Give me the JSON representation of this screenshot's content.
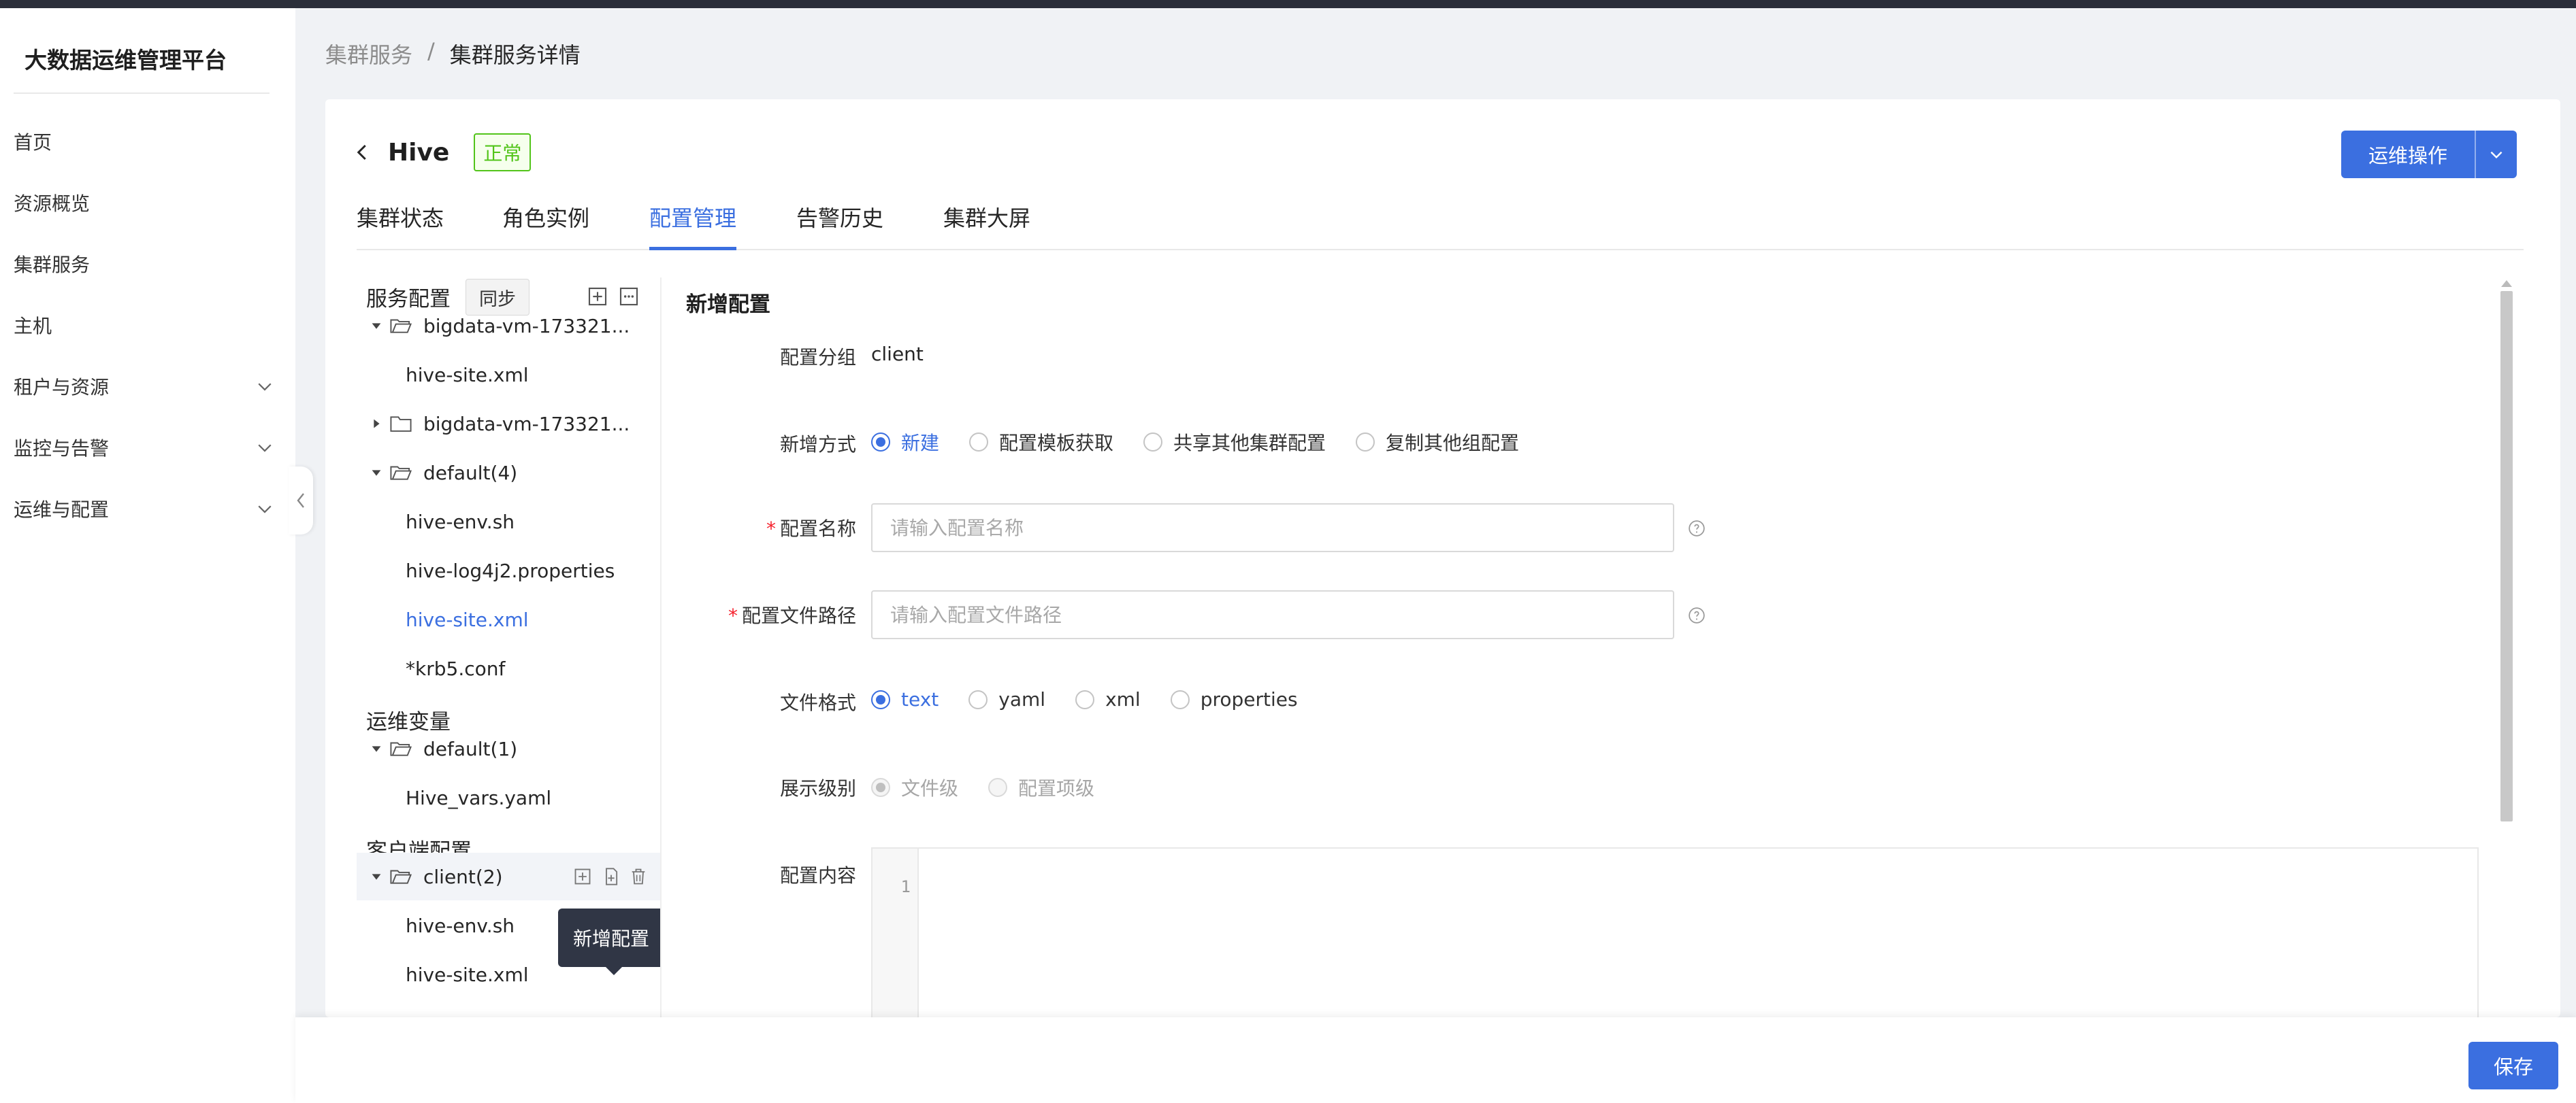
{
  "app": {
    "title": "大数据运维管理平台"
  },
  "sidebar": {
    "items": [
      {
        "label": "首页",
        "expandable": false
      },
      {
        "label": "资源概览",
        "expandable": false
      },
      {
        "label": "集群服务",
        "expandable": false
      },
      {
        "label": "主机",
        "expandable": false
      },
      {
        "label": "租户与资源",
        "expandable": true
      },
      {
        "label": "监控与告警",
        "expandable": true
      },
      {
        "label": "运维与配置",
        "expandable": true
      }
    ]
  },
  "breadcrumb": {
    "parent": "集群服务",
    "separator": "/",
    "current": "集群服务详情"
  },
  "header": {
    "service_name": "Hive",
    "status": "正常",
    "ops_button": "运维操作"
  },
  "tabs": [
    "集群状态",
    "角色实例",
    "配置管理",
    "告警历史",
    "集群大屏"
  ],
  "active_tab": 2,
  "tree": {
    "service_config_title": "服务配置",
    "sync_label": "同步",
    "service_nodes": [
      {
        "label": "bigdata-vm-173321...",
        "type": "folder",
        "expanded": true
      },
      {
        "label": "hive-site.xml",
        "type": "file"
      },
      {
        "label": "bigdata-vm-173321...",
        "type": "folder",
        "expanded": false
      },
      {
        "label": "default(4)",
        "type": "folder",
        "expanded": true
      },
      {
        "label": "hive-env.sh",
        "type": "file"
      },
      {
        "label": "hive-log4j2.properties",
        "type": "file"
      },
      {
        "label": "hive-site.xml",
        "type": "file",
        "active": true
      },
      {
        "label": "*krb5.conf",
        "type": "file"
      }
    ],
    "ops_vars_title": "运维变量",
    "ops_nodes": [
      {
        "label": "default(1)",
        "type": "folder",
        "expanded": true
      },
      {
        "label": "Hive_vars.yaml",
        "type": "file"
      }
    ],
    "client_config_title": "客户端配置",
    "client_nodes": [
      {
        "label": "client(2)",
        "type": "folder",
        "expanded": true,
        "hovered": true
      },
      {
        "label": "hive-env.sh",
        "type": "file"
      },
      {
        "label": "hive-site.xml",
        "type": "file"
      }
    ],
    "tooltip": "新增配置"
  },
  "form": {
    "title": "新增配置",
    "group_label": "配置分组",
    "group_value": "client",
    "method_label": "新增方式",
    "method_options": [
      "新建",
      "配置模板获取",
      "共享其他集群配置",
      "复制其他组配置"
    ],
    "method_selected": 0,
    "name_label": "配置名称",
    "name_placeholder": "请输入配置名称",
    "path_label": "配置文件路径",
    "path_placeholder": "请输入配置文件路径",
    "format_label": "文件格式",
    "format_options": [
      "text",
      "yaml",
      "xml",
      "properties"
    ],
    "format_selected": 0,
    "level_label": "展示级别",
    "level_options": [
      "文件级",
      "配置项级"
    ],
    "level_selected": 0,
    "content_label": "配置内容",
    "editor_line": "1"
  },
  "footer": {
    "save_label": "保存"
  },
  "colors": {
    "primary": "#3b6fe0",
    "success": "#52c41a",
    "required": "#f5222d",
    "tooltip_bg": "#303645"
  }
}
